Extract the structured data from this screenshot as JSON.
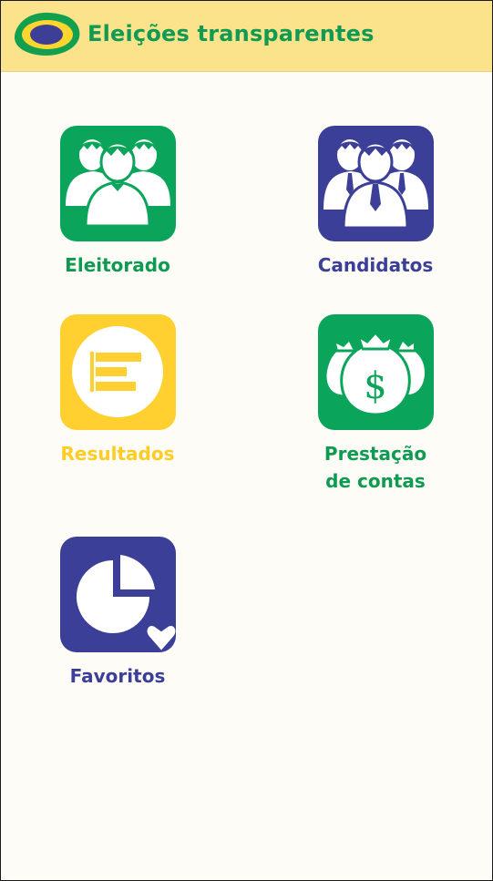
{
  "header": {
    "title": "Eleições transparentes",
    "logo_icon": "brazil-flag-icon"
  },
  "menu": {
    "items": [
      {
        "label": "Eleitorado",
        "icon": "voters-group-icon",
        "color": "#0aa55a",
        "label_color": "#0f9a52"
      },
      {
        "label": "Candidatos",
        "icon": "candidates-group-icon",
        "color": "#3c3f97",
        "label_color": "#3c3f97"
      },
      {
        "label": "Resultados",
        "icon": "results-bar-icon",
        "color": "#ffd02f",
        "label_color": "#ffcb25"
      },
      {
        "label": "Prestação\nde contas",
        "icon": "money-bags-icon",
        "color": "#0aa55a",
        "label_color": "#0f9a52"
      },
      {
        "label": "Favoritos",
        "icon": "favorites-pie-heart-icon",
        "color": "#3c3f97",
        "label_color": "#3c3f97"
      }
    ]
  },
  "colors": {
    "header_bg": "#fbe38c",
    "page_bg": "#fdfcf6",
    "brand_green": "#109a53",
    "brand_blue": "#3c3f97",
    "brand_yellow": "#ffd02f"
  }
}
